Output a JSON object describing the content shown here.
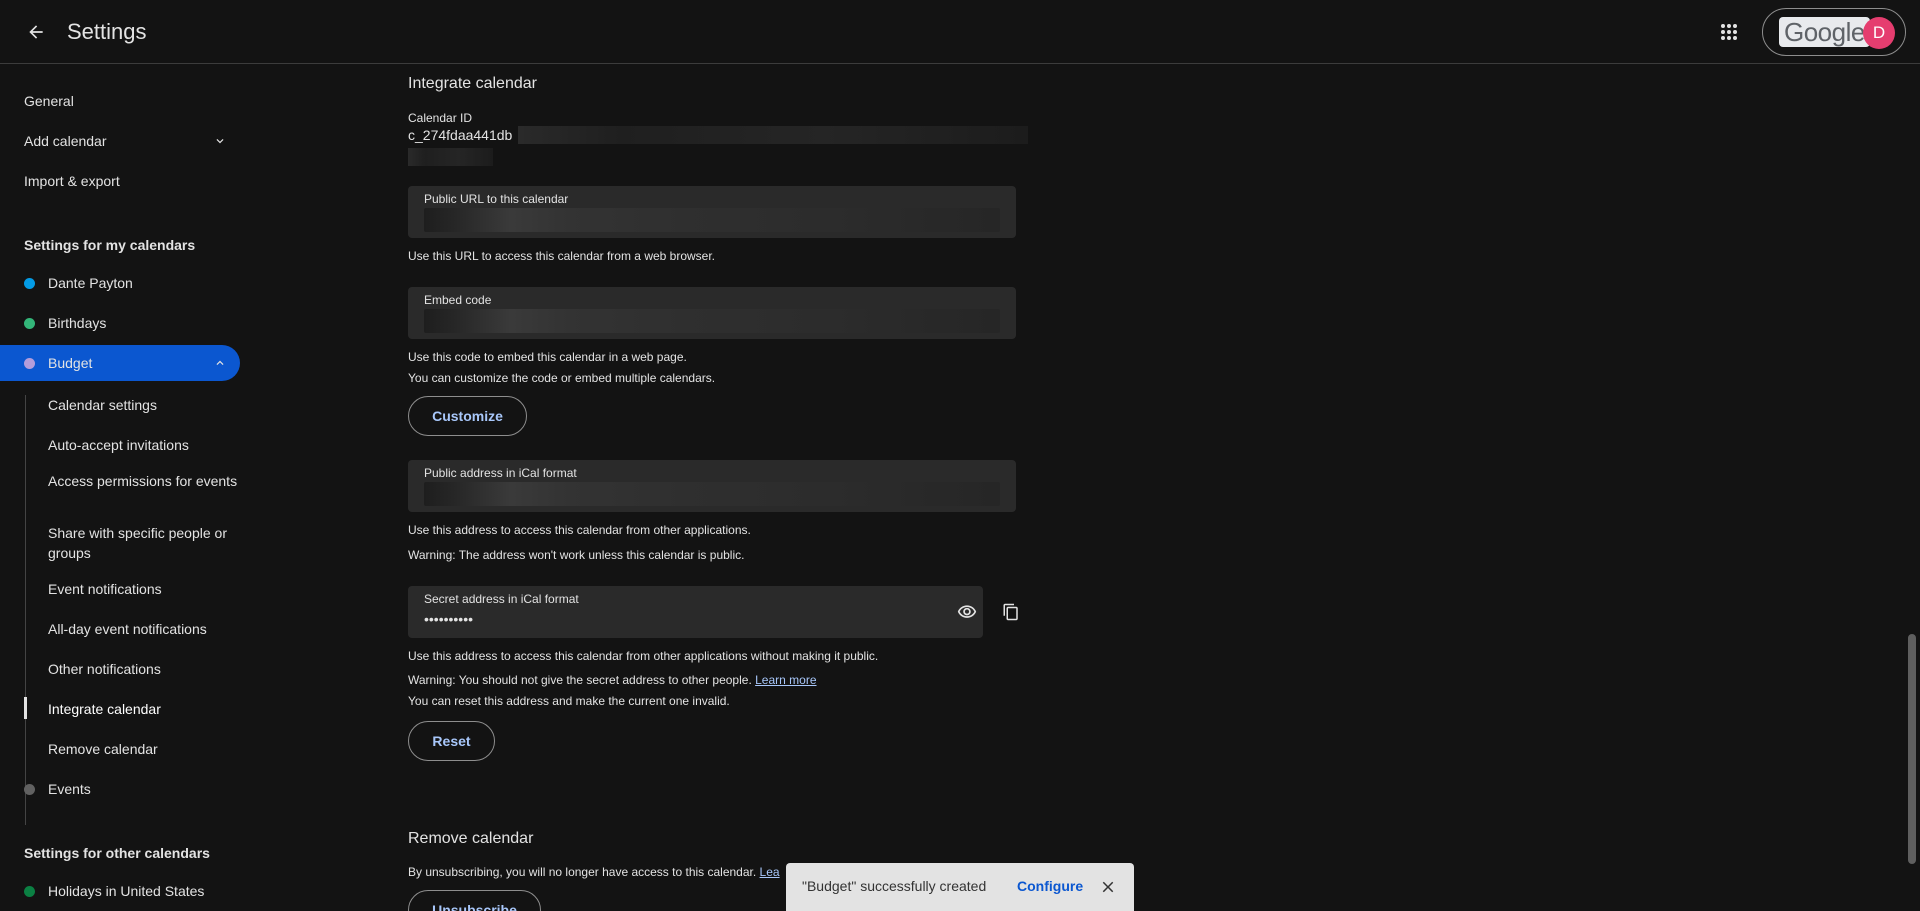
{
  "header": {
    "title": "Settings",
    "logo_text": "Google",
    "avatar_initial": "D"
  },
  "sidebar": {
    "top_items": [
      "General",
      "Add calendar",
      "Import & export"
    ],
    "my_calendars_heading": "Settings for my calendars",
    "my_calendars": [
      {
        "name": "Dante Payton",
        "color": "#039be5"
      },
      {
        "name": "Birthdays",
        "color": "#33b679"
      },
      {
        "name": "Budget",
        "color": "#b39ddb"
      }
    ],
    "budget_subitems": [
      "Calendar settings",
      "Auto-accept invitations",
      "Access permissions for events",
      "Share with specific people or groups",
      "Event notifications",
      "All-day event notifications",
      "Other notifications",
      "Integrate calendar",
      "Remove calendar"
    ],
    "events_item": {
      "name": "Events",
      "color": "#616161"
    },
    "other_calendars_heading": "Settings for other calendars",
    "other_calendars": [
      {
        "name": "Holidays in United States",
        "color": "#0b8043"
      }
    ]
  },
  "main": {
    "integrate_title": "Integrate calendar",
    "calendar_id_label": "Calendar ID",
    "calendar_id_value": "c_274fdaa441db",
    "public_url_label": "Public URL to this calendar",
    "public_url_hint": "Use this URL to access this calendar from a web browser.",
    "embed_label": "Embed code",
    "embed_hint1": "Use this code to embed this calendar in a web page.",
    "embed_hint2": "You can customize the code or embed multiple calendars.",
    "customize_button": "Customize",
    "ical_public_label": "Public address in iCal format",
    "ical_public_hint1": "Use this address to access this calendar from other applications.",
    "ical_public_hint2": "Warning: The address won't work unless this calendar is public.",
    "secret_label": "Secret address in iCal format",
    "secret_value": "••••••••••",
    "secret_hint1": "Use this address to access this calendar from other applications without making it public.",
    "secret_hint2": "Warning: You should not give the secret address to other people.",
    "learn_more": "Learn more",
    "secret_hint3": "You can reset this address and make the current one invalid.",
    "reset_button": "Reset",
    "remove_title": "Remove calendar",
    "remove_hint": "By unsubscribing, you will no longer have access to this calendar.",
    "remove_link_partial": "Lea",
    "unsubscribe_button": "Unsubscribe"
  },
  "snackbar": {
    "message": "\"Budget\" successfully created",
    "action": "Configure"
  }
}
